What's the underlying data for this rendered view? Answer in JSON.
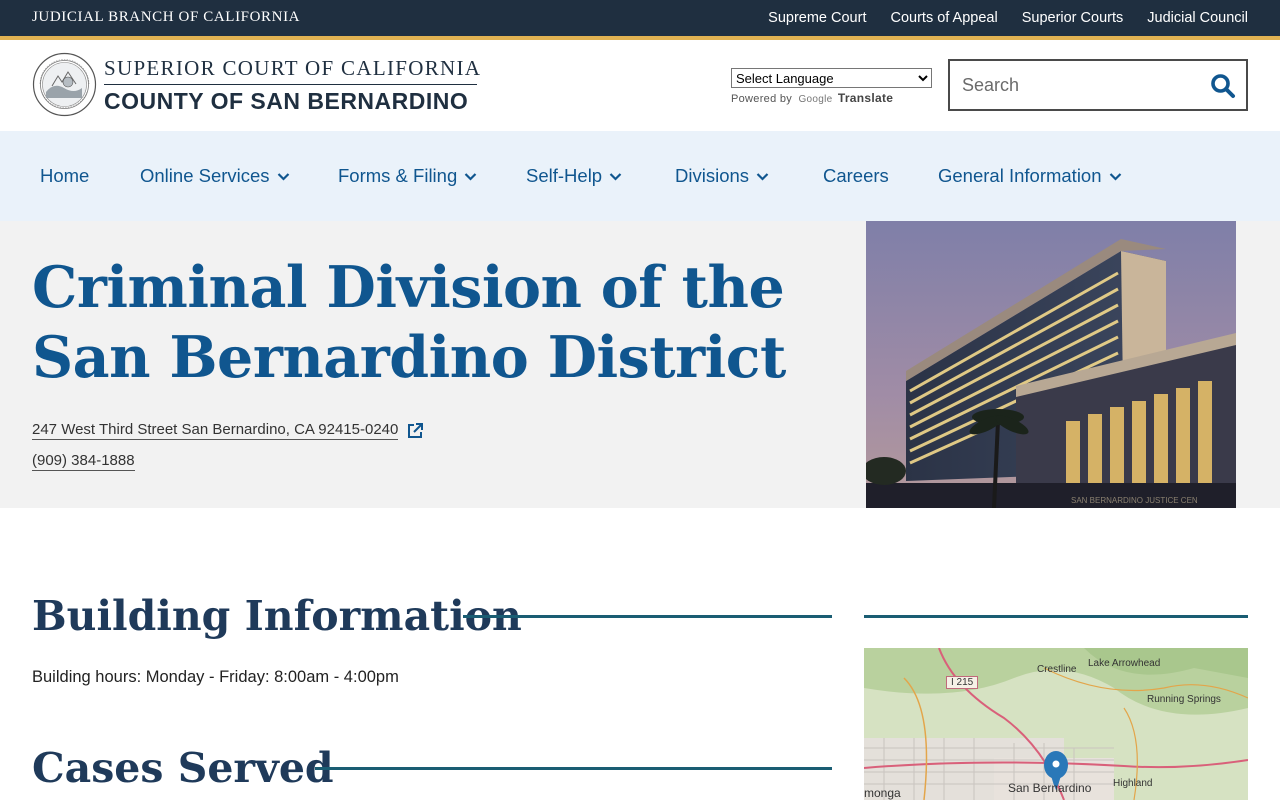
{
  "topbar": {
    "brand": "JUDICIAL BRANCH OF CALIFORNIA",
    "links": [
      "Supreme Court",
      "Courts of Appeal",
      "Superior Courts",
      "Judicial Council"
    ]
  },
  "header": {
    "line1": "SUPERIOR COURT OF CALIFORNIA",
    "line2": "COUNTY OF SAN BERNARDINO",
    "language_select": "Select Language",
    "powered_by": "Powered by",
    "google": "Google",
    "translate": "Translate",
    "search_placeholder": "Search"
  },
  "nav": {
    "items": [
      {
        "label": "Home"
      },
      {
        "label": "Online Services"
      },
      {
        "label": "Forms & Filing"
      },
      {
        "label": "Self-Help"
      },
      {
        "label": "Divisions"
      },
      {
        "label": "Careers"
      },
      {
        "label": "General Information"
      }
    ]
  },
  "hero": {
    "title": "Criminal Division of the San Bernardino District",
    "address": "247 West Third Street San Bernardino, CA 92415-0240",
    "phone": "(909) 384-1888",
    "photo_caption": "SAN BERNARDINO JUSTICE CEN"
  },
  "main": {
    "building_title": "Building Information",
    "building_hours": "Building hours: Monday - Friday: 8:00am - 4:00pm",
    "cases_title": "Cases Served"
  },
  "map": {
    "labels": [
      "Crestline",
      "Lake Arrowhead",
      "Running Springs",
      "San Bernardino",
      "Highland",
      "monga",
      "I 215"
    ]
  },
  "colors": {
    "topbar": "#1f2f40",
    "gold": "#e0b252",
    "nav_bg": "#eaf2fa",
    "link_blue": "#10568f",
    "heading": "#1f3a5a",
    "rule": "#1a5d73"
  }
}
